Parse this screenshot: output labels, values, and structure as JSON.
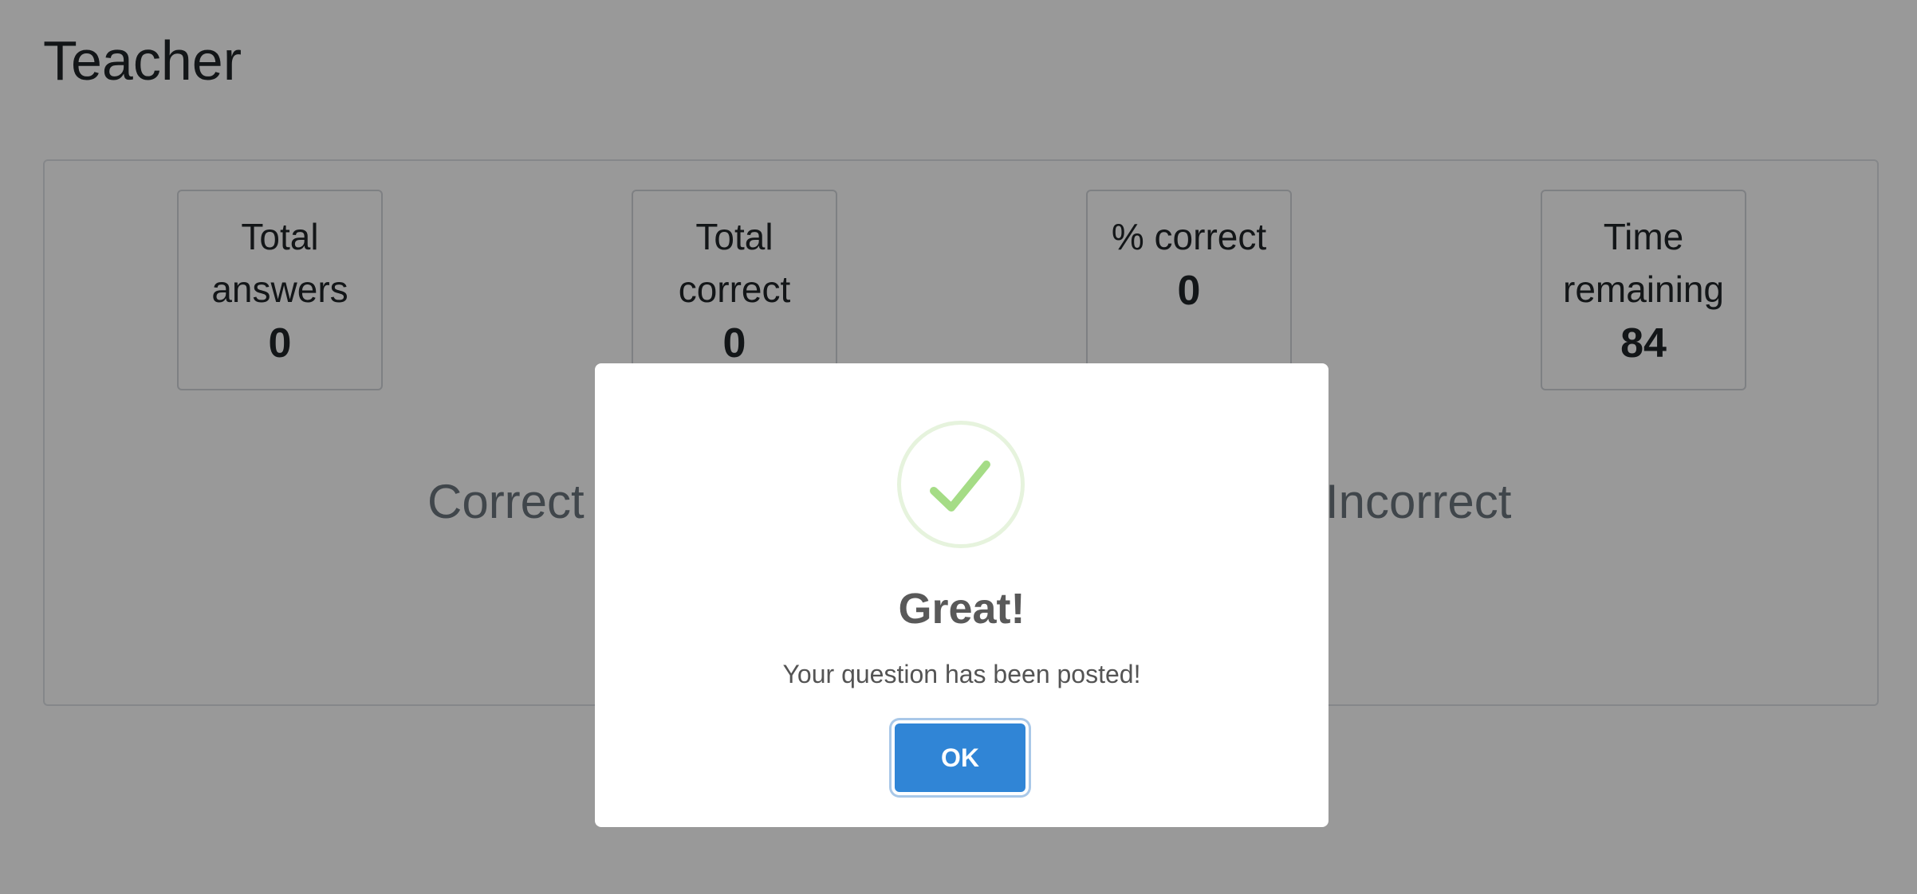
{
  "page": {
    "title": "Teacher"
  },
  "stats": [
    {
      "label": "Total answers",
      "value": "0"
    },
    {
      "label": "Total correct",
      "value": "0"
    },
    {
      "label": "% correct",
      "value": "0"
    },
    {
      "label": "Time remaining",
      "value": "84"
    }
  ],
  "charts": {
    "correct_label": "Correct",
    "incorrect_label": "Incorrect"
  },
  "modal": {
    "icon": "checkmark-icon",
    "title": "Great!",
    "message": "Your question has been posted!",
    "ok_label": "OK"
  },
  "colors": {
    "button": "#3085d6",
    "success": "#a5dc86",
    "overlay": "rgba(0,0,0,0.4)"
  }
}
